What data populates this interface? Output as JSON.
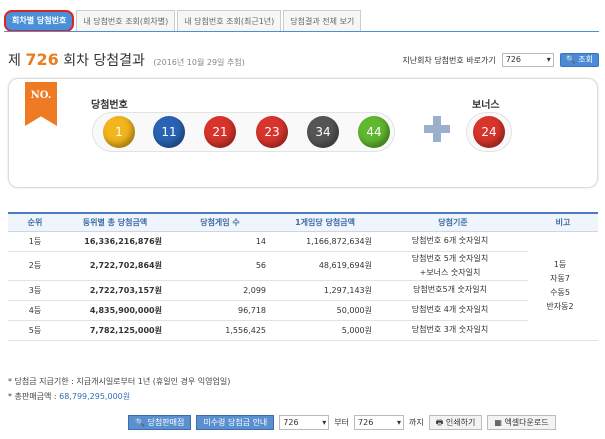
{
  "tabs": [
    "회차별 당첨번호",
    "내 당첨번호 조회(회차별)",
    "내 당첨번호 조회(최근1년)",
    "당첨결과 전체 보기"
  ],
  "round": {
    "prefix": "제",
    "number": "726",
    "suffix": "회차 당첨결과",
    "date": "(2016년 10월 29일 추첨)"
  },
  "goto": {
    "label": "지난회차 당첨번호 바로가기",
    "selected": "726",
    "button": "조회"
  },
  "numbers": {
    "ribbon": "NO.",
    "win_label": "당첨번호",
    "bonus_label": "보너스",
    "balls": [
      {
        "value": "1",
        "color": "#f2b51c"
      },
      {
        "value": "11",
        "color": "#2a63b5"
      },
      {
        "value": "21",
        "color": "#d8342c"
      },
      {
        "value": "23",
        "color": "#d8342c"
      },
      {
        "value": "34",
        "color": "#555555"
      },
      {
        "value": "44",
        "color": "#5fb82e"
      }
    ],
    "bonus": {
      "value": "24",
      "color": "#d8342c"
    }
  },
  "table": {
    "headers": [
      "순위",
      "등위별 총 당첨금액",
      "당첨게임 수",
      "1게임당 당첨금액",
      "당첨기준",
      "비고"
    ],
    "rows": [
      {
        "rank": "1등",
        "total": "16,336,216,876원",
        "games": "14",
        "per_game": "1,166,872,634원",
        "criteria": "당첨번호 6개 숫자일치",
        "criteria2": ""
      },
      {
        "rank": "2등",
        "total": "2,722,702,864원",
        "games": "56",
        "per_game": "48,619,694원",
        "criteria": "당첨번호 5개 숫자일치",
        "criteria2": "+보너스 숫자일치"
      },
      {
        "rank": "3등",
        "total": "2,722,703,157원",
        "games": "2,099",
        "per_game": "1,297,143원",
        "criteria": "당첨번호5개 숫자일치",
        "criteria2": ""
      },
      {
        "rank": "4등",
        "total": "4,835,900,000원",
        "games": "96,718",
        "per_game": "50,000원",
        "criteria": "당첨번호 4개 숫자일치",
        "criteria2": ""
      },
      {
        "rank": "5등",
        "total": "7,782,125,000원",
        "games": "1,556,425",
        "per_game": "5,000원",
        "criteria": "당첨번호 3개 숫자일치",
        "criteria2": ""
      }
    ],
    "remark": [
      "1등",
      "자동7",
      "수동5",
      "반자동2"
    ]
  },
  "notes": {
    "line1": "* 당첨금 지급기한 : 지급개시일로부터 1년 (휴일인 경우 익영업일)",
    "line2_label": "* 총판매금액 : ",
    "line2_value": "68,799,295,000원"
  },
  "bottom": {
    "btn_store": "당첨판매점",
    "btn_unpaid": "미수령 당첨금 안내",
    "from_value": "726",
    "from_label": "부터",
    "to_value": "726",
    "to_label": "까지",
    "btn_print": "인쇄하기",
    "btn_excel": "엑셀다운로드"
  }
}
